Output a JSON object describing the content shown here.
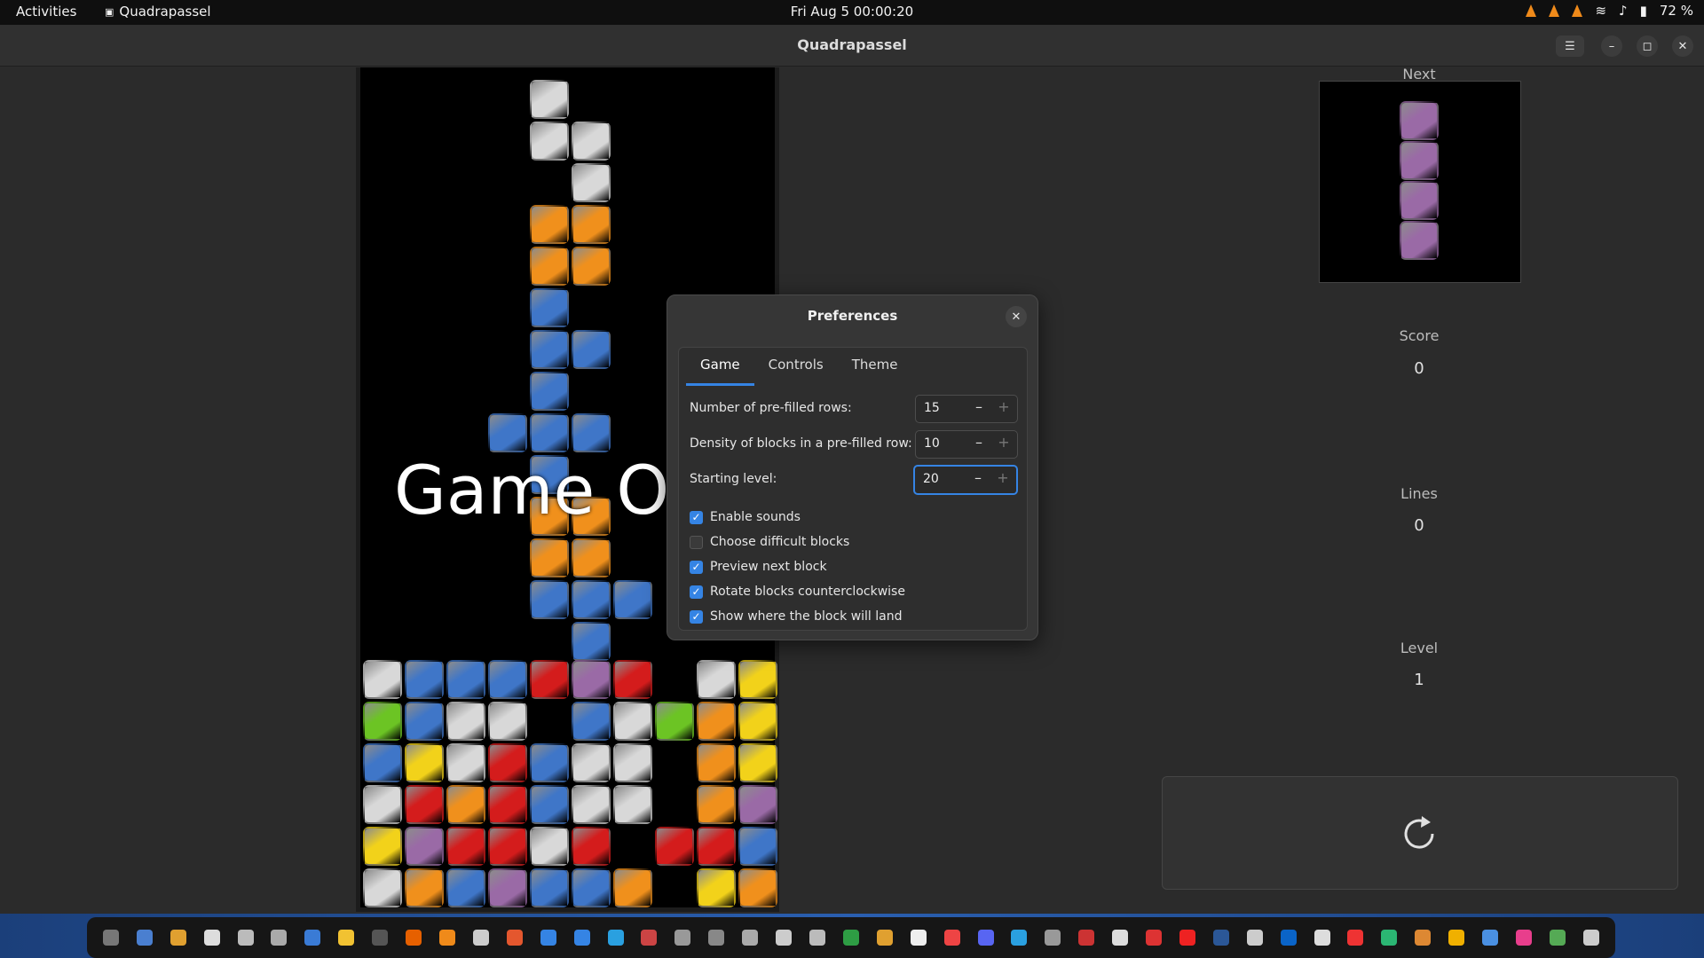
{
  "topbar": {
    "activities": "Activities",
    "app_name": "Quadrapassel",
    "clock": "Fri Aug 5  00:00:20",
    "battery": "72 %"
  },
  "window": {
    "title": "Quadrapassel"
  },
  "game": {
    "overlay_text": "Game Over",
    "block_colors": {
      "w": "#d8d8d8",
      "o": "#f0901c",
      "b": "#3f76c8",
      "r": "#d41c1c",
      "y": "#f2d21a",
      "g": "#6cc424",
      "p": "#9a6aa6"
    },
    "columns": 10,
    "falling_rows": [
      "....w.....",
      "....ww....",
      ".....w....",
      "....oo....",
      "....oo....",
      "....b.....",
      "....bb....",
      "....b.....",
      "...bbb....",
      "....b.....",
      "....oo....",
      "....oo....",
      "....bbb...",
      ".....b...."
    ],
    "stack_rows": [
      "wbbbrpr.wy",
      "gbww.bwgoy",
      "bywrbww.oy",
      "wrorbww.op",
      "yprrwr.rrb",
      "wobpbbo.yo"
    ]
  },
  "side": {
    "next_label": "Next",
    "next_piece_color": "#9a6aa6",
    "score_label": "Score",
    "score_value": "0",
    "lines_label": "Lines",
    "lines_value": "0",
    "level_label": "Level",
    "level_value": "1"
  },
  "preferences": {
    "title": "Preferences",
    "tabs": [
      "Game",
      "Controls",
      "Theme"
    ],
    "active_tab": "Game",
    "prefilled_rows_label": "Number of pre-filled rows:",
    "prefilled_rows_value": "15",
    "density_label": "Density of blocks in a pre-filled row:",
    "density_value": "10",
    "starting_level_label": "Starting level:",
    "starting_level_value": "20",
    "options": [
      {
        "label": "Enable sounds",
        "checked": true
      },
      {
        "label": "Choose difficult blocks",
        "checked": false
      },
      {
        "label": "Preview next block",
        "checked": true
      },
      {
        "label": "Rotate blocks counterclockwise",
        "checked": true
      },
      {
        "label": "Show where the block will land",
        "checked": true
      }
    ]
  },
  "dock": {
    "icons": [
      "terminal-icon",
      "files-icon",
      "chrome-icon",
      "text-editor-icon",
      "archive-icon",
      "search-app-icon",
      "document-icon",
      "spreadsheet-icon",
      "shell-icon",
      "firefox-icon",
      "vlc-icon",
      "settings-ring-icon",
      "store-icon",
      "notes-icon",
      "writer-icon",
      "help-icon",
      "monitor-icon",
      "camera-icon",
      "game-icon",
      "arrow-icon",
      "box-icon",
      "screenshot-icon",
      "calc-icon",
      "folder-icon",
      "doc2-icon",
      "pdf-icon",
      "discord-icon",
      "telegram-icon",
      "clock-icon",
      "image-icon",
      "percent-icon",
      "media-icon",
      "red-app-icon",
      "word-icon",
      "compass-icon",
      "outlook-icon",
      "disk-icon",
      "heart-icon",
      "green-app-icon",
      "character-icon",
      "chat-icon",
      "remote-icon",
      "quadrapassel-icon",
      "trash-icon",
      "app-grid-icon"
    ]
  }
}
